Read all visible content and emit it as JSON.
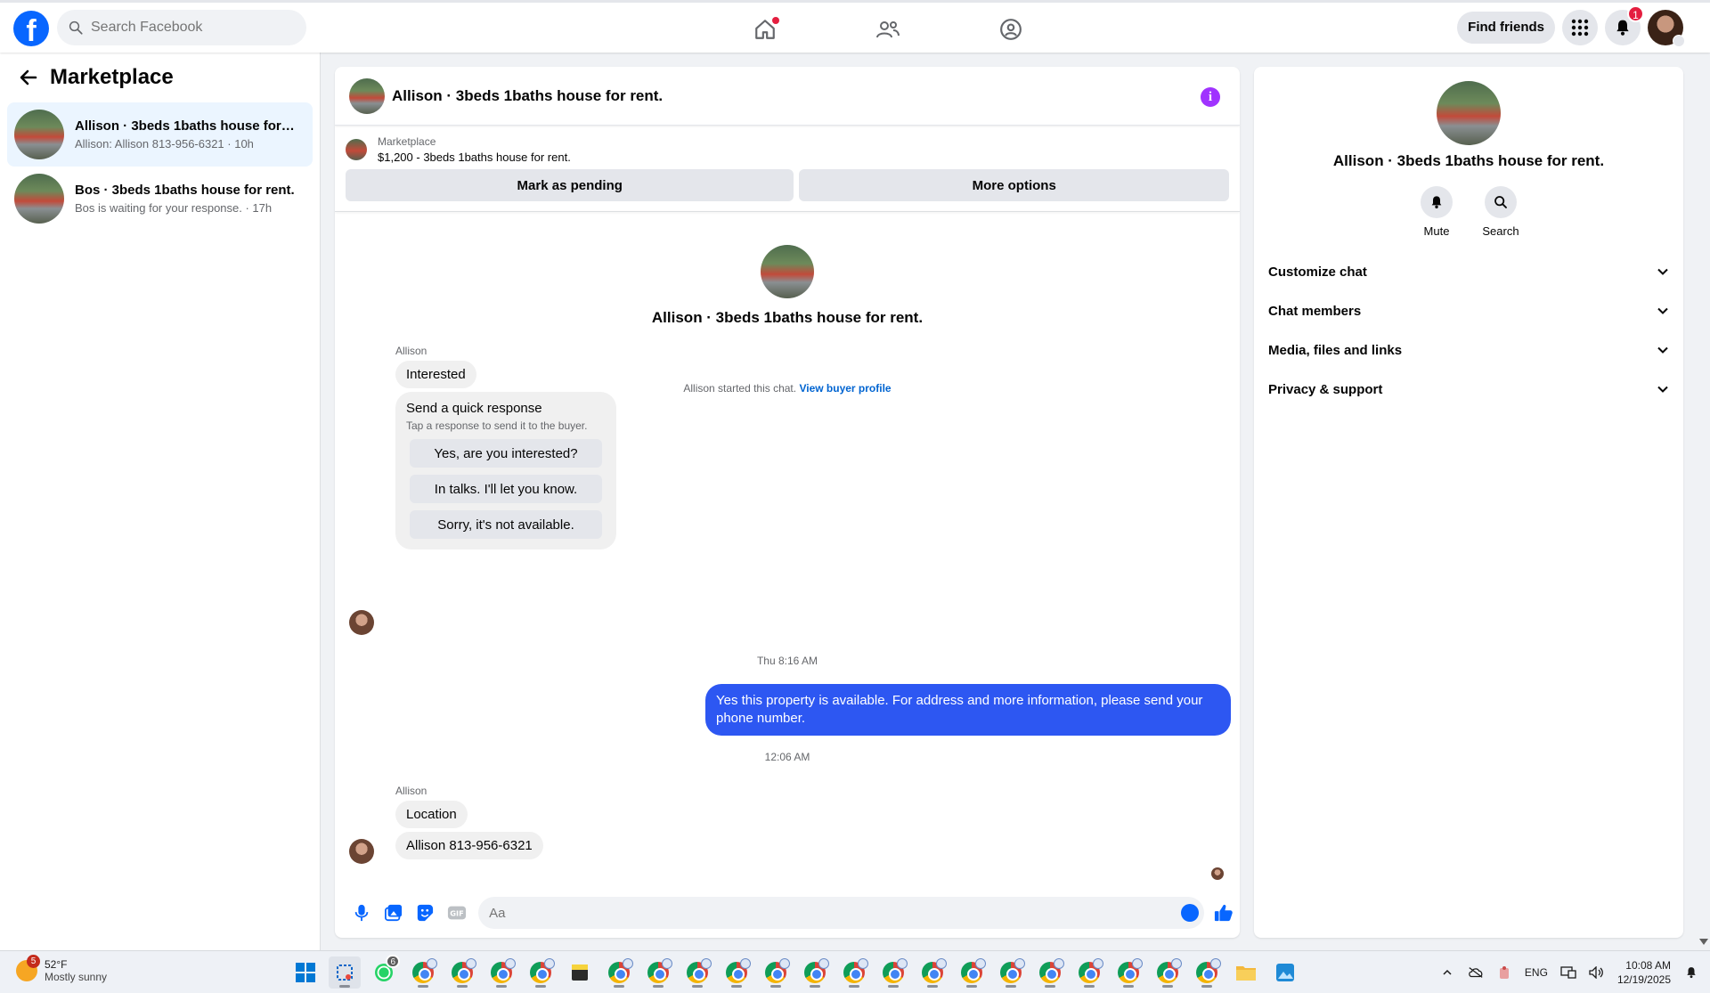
{
  "topbar": {
    "logo": "f",
    "search_placeholder": "Search Facebook",
    "find_friends": "Find friends",
    "notification_count": "1",
    "nav_icons": [
      "home-icon",
      "friends-icon",
      "groups-icon"
    ]
  },
  "sidebar": {
    "title": "Marketplace",
    "conversations": [
      {
        "name": "Allison · 3beds 1baths house for rent.",
        "preview": "Allison: Allison 813-956-6321 · 10h"
      },
      {
        "name": "Bos · 3beds 1baths house for rent.",
        "preview": "Bos is waiting for your response. · 17h"
      }
    ]
  },
  "chat": {
    "title": "Allison · 3beds 1baths house for rent.",
    "listing_label": "Marketplace",
    "listing_text": "$1,200 - 3beds 1baths house for rent.",
    "mark_pending": "Mark as pending",
    "more_options": "More options",
    "intro_name": "Allison · 3beds 1baths house for rent.",
    "started_text": "Allison started this chat.",
    "view_profile": "View buyer profile",
    "sender1": "Allison",
    "msg_interested": "Interested",
    "quick_title": "Send a quick response",
    "quick_sub": "Tap a response to send it to the buyer.",
    "quick_replies": [
      "Yes, are you interested?",
      "In talks. I'll let you know.",
      "Sorry, it's not available."
    ],
    "ts1": "Thu 8:16 AM",
    "outgoing": "Yes this property is available. For address and more information, please send your phone number.",
    "ts2": "12:06 AM",
    "sender2": "Allison",
    "msg_location": "Location",
    "msg_phone": "Allison 813-956-6321",
    "composer_placeholder": "Aa"
  },
  "right_panel": {
    "name": "Allison · 3beds 1baths house for rent.",
    "mute": "Mute",
    "search": "Search",
    "items": [
      "Customize chat",
      "Chat members",
      "Media, files and links",
      "Privacy & support"
    ]
  },
  "taskbar": {
    "temp": "52°F",
    "weather": "Mostly sunny",
    "weather_badge": "5",
    "whatsapp_badge": "6",
    "lang": "ENG",
    "time": "10:08 AM",
    "date": "12/19/2025"
  },
  "colors": {
    "brand": "#0866ff",
    "outgoing_bubble": "#2d57f2",
    "info_icon": "#a033ff",
    "badge": "#e41e3f"
  }
}
